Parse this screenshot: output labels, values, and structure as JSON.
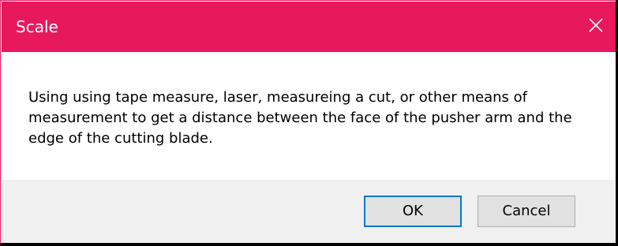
{
  "dialog": {
    "title": "Scale",
    "close_icon": "close-icon",
    "message": "Using using tape measure, laser, measureing a cut, or other means of measurement to get a distance between the face of the pusher arm and the edge of the cutting blade.",
    "ok_label": "OK",
    "cancel_label": "Cancel"
  },
  "colors": {
    "titlebar": "#e8185c",
    "footer": "#f0f0f0",
    "default_button_border": "#0078d7"
  }
}
